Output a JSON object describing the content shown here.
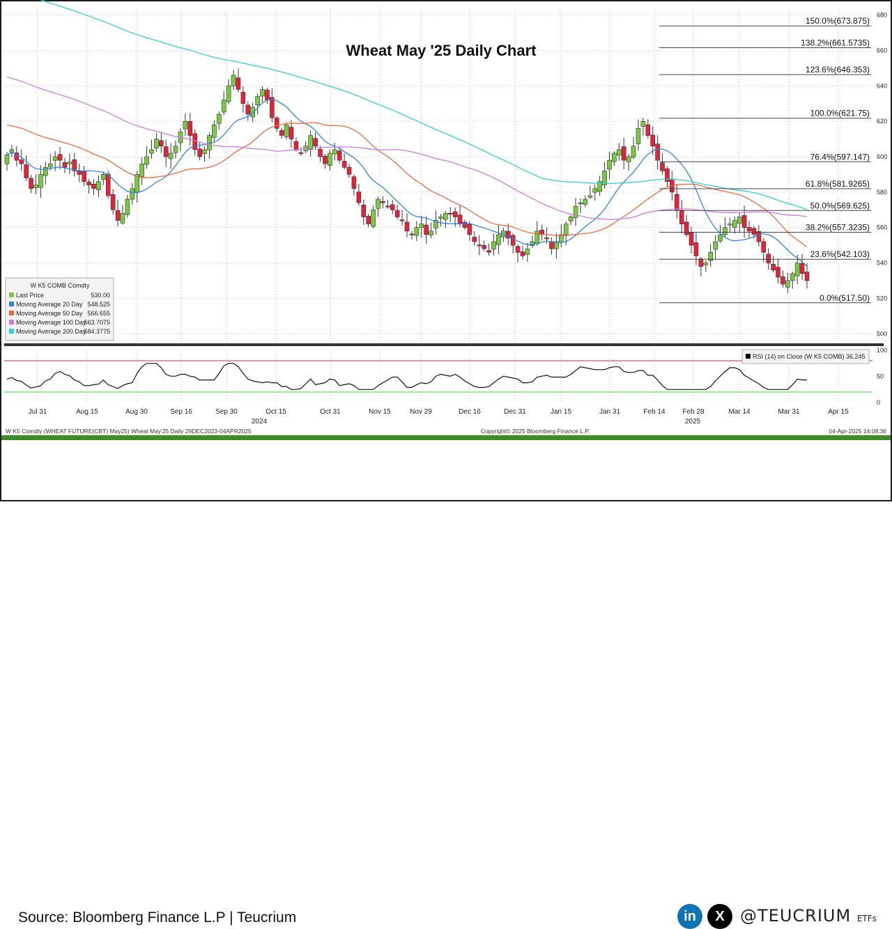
{
  "chart_data": {
    "type": "candlestick",
    "title": "Wheat May '25 Daily Chart",
    "ylim": [
      495,
      683
    ],
    "y_ticks": [
      "500",
      "520",
      "540",
      "560",
      "580",
      "600",
      "620",
      "640",
      "660",
      "680"
    ],
    "x_ticks": [
      "Jul 31",
      "Aug 15",
      "Aug 30",
      "Sep 16",
      "Sep 30",
      "Oct 15",
      "Oct 31",
      "Nov 15",
      "Nov 29",
      "Dec 16",
      "Dec 31",
      "Jan 15",
      "Jan 31",
      "Feb 14",
      "Feb 28",
      "Mar 14",
      "Mar 31",
      "Apr 15"
    ],
    "year_labels": [
      "2024",
      "2025"
    ],
    "fibonacci": [
      {
        "label": "150.0%(673.875)",
        "value": 673.875
      },
      {
        "label": "138.2%(661.5735)",
        "value": 661.5735
      },
      {
        "label": "123.6%(646.353)",
        "value": 646.353
      },
      {
        "label": "100.0%(621.75)",
        "value": 621.75
      },
      {
        "label": "76.4%(597.147)",
        "value": 597.147
      },
      {
        "label": "61.8%(581.9265)",
        "value": 581.9265
      },
      {
        "label": "50.0%(569.625)",
        "value": 569.625
      },
      {
        "label": "38.2%(557.3235)",
        "value": 557.3235
      },
      {
        "label": "23.6%(542.103)",
        "value": 542.103
      },
      {
        "label": "0.0%(517.50)",
        "value": 517.5
      }
    ],
    "closes": [
      601,
      604,
      598,
      596,
      588,
      582,
      584,
      590,
      594,
      596,
      600,
      598,
      594,
      597,
      592,
      590,
      586,
      584,
      582,
      586,
      590,
      578,
      570,
      564,
      568,
      576,
      582,
      590,
      596,
      600,
      604,
      610,
      606,
      600,
      602,
      606,
      614,
      620,
      612,
      604,
      600,
      604,
      612,
      618,
      624,
      632,
      640,
      646,
      638,
      630,
      624,
      628,
      634,
      638,
      632,
      622,
      616,
      612,
      618,
      610,
      604,
      602,
      606,
      612,
      606,
      600,
      596,
      602,
      604,
      598,
      594,
      590,
      582,
      574,
      566,
      562,
      570,
      576,
      574,
      572,
      570,
      566,
      564,
      558,
      556,
      560,
      562,
      556,
      558,
      564,
      566,
      568,
      568,
      566,
      562,
      560,
      556,
      552,
      550,
      548,
      546,
      552,
      556,
      558,
      554,
      550,
      546,
      544,
      548,
      552,
      558,
      556,
      554,
      548,
      552,
      556,
      562,
      566,
      572,
      574,
      576,
      578,
      582,
      586,
      592,
      598,
      602,
      604,
      598,
      600,
      606,
      616,
      620,
      612,
      606,
      598,
      592,
      586,
      580,
      570,
      562,
      556,
      550,
      544,
      538,
      540,
      546,
      552,
      556,
      560,
      562,
      564,
      566,
      560,
      558,
      556,
      552,
      546,
      540,
      536,
      532,
      528,
      530,
      534,
      540,
      534,
      530
    ],
    "moving_averages": [
      {
        "name": "Moving Average 20 Day",
        "color": "#2e86de"
      },
      {
        "name": "Moving Average 50 Day",
        "color": "#ee6a3f"
      },
      {
        "name": "Moving Average 100 Day",
        "color": "#d07ae0"
      },
      {
        "name": "Moving Average 200 Day",
        "color": "#31d0cf"
      }
    ],
    "rsi": {
      "ylim": [
        0,
        100
      ],
      "y_ticks": [
        "0",
        "50",
        "100"
      ],
      "upper": 80,
      "lower": 20
    }
  },
  "legend": {
    "header": "W K5 COMB Comdty",
    "rows": [
      {
        "label": "Last Price",
        "value": "530.00",
        "color": "#7ac943"
      },
      {
        "label": "Moving Average 20 Day",
        "value": "548.525",
        "color": "#2e86de"
      },
      {
        "label": "Moving Average 50 Day",
        "value": "566.655",
        "color": "#ee6a3f"
      },
      {
        "label": "Moving Average 100 Day",
        "value": "563.7075",
        "color": "#d07ae0"
      },
      {
        "label": "Moving Average 200 Day",
        "value": "584.3775",
        "color": "#31d0cf"
      }
    ]
  },
  "rsi_legend": {
    "text": "RSI (14)  on Close (W K5 COMB) 36.245"
  },
  "bottom_bar": {
    "left": "W K5 Comdty (WHEAT FUTURE(CBT) May25) Wheat May'25  Daily 29DEC2023-04APR2025",
    "center": "Copyright© 2025 Bloomberg Finance L.P.",
    "right": "04-Apr-2025 14:08:36"
  },
  "footer": {
    "source": "Source: Bloomberg Finance L.P | Teucrium",
    "linkedin": "in",
    "x_icon": "X",
    "brand": "@TEUCRIUM",
    "brand_suffix": "ETFs"
  },
  "colors": {
    "up": "#7ac943",
    "down": "#e3223c",
    "divider": "#3c8c28"
  }
}
